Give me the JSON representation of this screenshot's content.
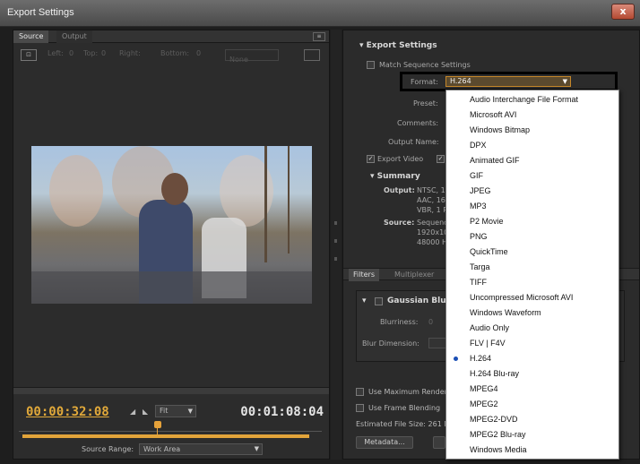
{
  "window": {
    "title": "Export Settings",
    "close": "x"
  },
  "source_panel": {
    "tabs": [
      "Source",
      "Output"
    ],
    "crop": {
      "left_label": "Left:",
      "left": "0",
      "top_label": "Top:",
      "top": "0",
      "right_label": "Right:",
      "bottom_label": "Bottom:",
      "bottom": "0",
      "ratio": "None"
    },
    "current_time": "00:00:32:08",
    "duration": "00:01:08:04",
    "fit": "Fit",
    "source_range_label": "Source Range:",
    "source_range": "Work Area"
  },
  "export_settings": {
    "header": "Export Settings",
    "match_sequence": "Match Sequence Settings",
    "format_label": "Format:",
    "format_value": "H.264",
    "preset_label": "Preset:",
    "comments_label": "Comments:",
    "output_name_label": "Output Name:",
    "export_video": "Export Video",
    "summary_header": "Summary",
    "output_label": "Output:",
    "output_lines": [
      "NTSC, 1",
      "AAC, 16",
      "VBR, 1 P"
    ],
    "source_label": "Source:",
    "source_lines": [
      "Sequenc",
      "1920x10",
      "48000 H"
    ]
  },
  "lower_panel": {
    "tabs": [
      "Filters",
      "Multiplexer"
    ],
    "filter_name": "Gaussian Blur",
    "blurriness_label": "Blurriness:",
    "blurriness_value": "0",
    "blur_dimension_label": "Blur Dimension:",
    "use_max_render": "Use Maximum Render",
    "use_frame_blending": "Use Frame Blending",
    "estimated_size": "Estimated File Size: 261 N",
    "metadata_button": "Metadata..."
  },
  "format_dropdown": {
    "selected_index": 15,
    "items": [
      "Audio Interchange File Format",
      "Microsoft AVI",
      "Windows Bitmap",
      "DPX",
      "Animated GIF",
      "GIF",
      "JPEG",
      "MP3",
      "P2 Movie",
      "PNG",
      "QuickTime",
      "Targa",
      "TIFF",
      "Uncompressed Microsoft AVI",
      "Windows Waveform",
      "Audio Only",
      "FLV | F4V",
      "H.264",
      "H.264 Blu-ray",
      "MPEG4",
      "MPEG2",
      "MPEG2-DVD",
      "MPEG2 Blu-ray",
      "Windows Media"
    ]
  },
  "colors": {
    "accent": "#e1a93a",
    "selection": "#1b4fb5",
    "panel": "#2c2c2c"
  }
}
